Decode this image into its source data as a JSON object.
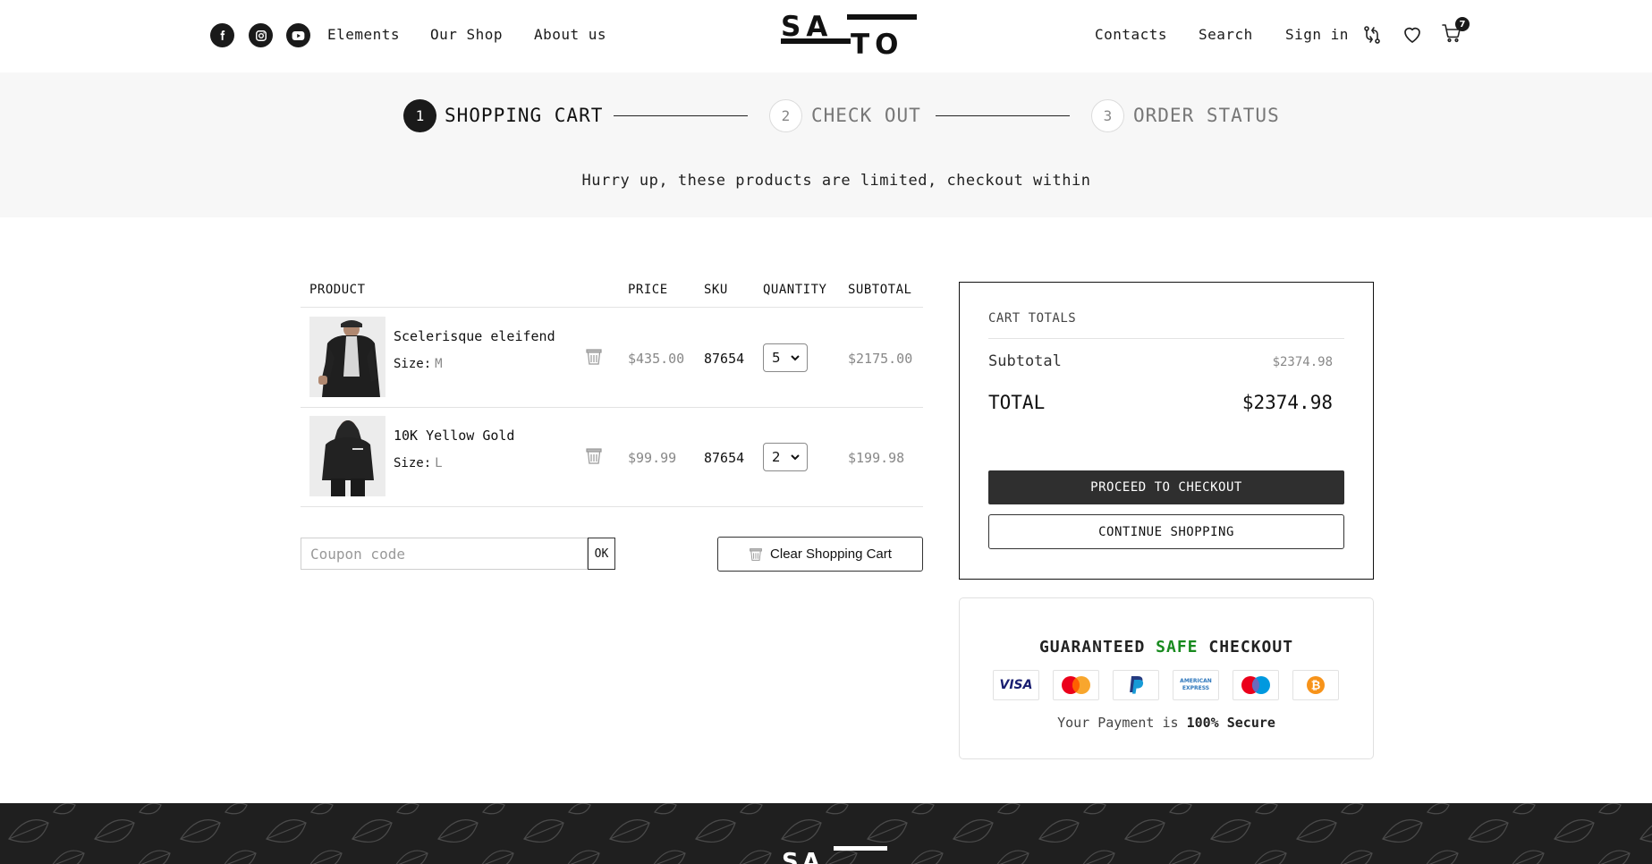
{
  "header": {
    "social": [
      "facebook-icon",
      "instagram-icon",
      "youtube-icon"
    ],
    "nav_left": [
      "Elements",
      "Our Shop",
      "About us"
    ],
    "logo": "SATO",
    "nav_right": [
      "Contacts",
      "Search",
      "Sign in"
    ],
    "cart_count": "7"
  },
  "steps": [
    {
      "num": "1",
      "label": "SHOPPING CART",
      "active": true
    },
    {
      "num": "2",
      "label": "CHECK OUT",
      "active": false
    },
    {
      "num": "3",
      "label": "ORDER STATUS",
      "active": false
    }
  ],
  "notice": "Hurry up, these products are limited, checkout within",
  "table": {
    "headers": [
      "PRODUCT",
      "PRICE",
      "SKU",
      "QUANTITY",
      "SUBTOTAL"
    ],
    "size_label": "Size:",
    "rows": [
      {
        "name": "Scelerisque eleifend",
        "size": "M",
        "price": "$435.00",
        "sku": "87654",
        "qty": "5",
        "subtotal": "$2175.00"
      },
      {
        "name": "10K Yellow Gold",
        "size": "L",
        "price": "$99.99",
        "sku": "87654",
        "qty": "2",
        "subtotal": "$199.98"
      }
    ]
  },
  "coupon": {
    "placeholder": "Coupon code",
    "ok_label": "OK"
  },
  "clear_label": "Clear Shopping Cart",
  "totals": {
    "title": "CART TOTALS",
    "subtotal_label": "Subtotal",
    "subtotal_value": "$2374.98",
    "total_label": "TOTAL",
    "total_value": "$2374.98",
    "checkout_label": "PROCEED TO CHECKOUT",
    "continue_label": "CONTINUE SHOPPING"
  },
  "safe_checkout": {
    "title_pre": "GUARANTEED",
    "title_accent": "SAFE",
    "title_post": "CHECKOUT",
    "accent_color": "#188a1e",
    "payment_methods": [
      "visa-icon",
      "mastercard-icon",
      "paypal-icon",
      "american-express-icon",
      "maestro-icon",
      "bitcoin-icon"
    ],
    "amex_text": "AMERICAN EXPRESS",
    "visa_text": "VISA",
    "note_pre": "Your Payment is",
    "note_bold": "100% Secure"
  }
}
